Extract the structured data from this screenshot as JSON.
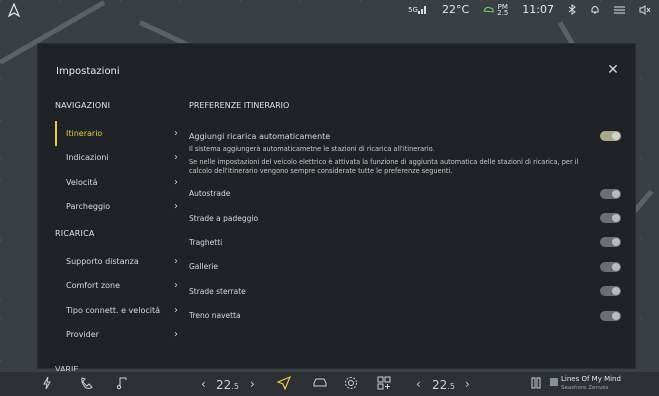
{
  "status": {
    "temperature": "22°C",
    "pm_label": "PM",
    "pm_value": "2.5",
    "signal": "5G",
    "time": "11:07"
  },
  "panel": {
    "title": "Impostazioni",
    "close_label": "✕"
  },
  "sidebar": {
    "navigation_header": "NAVIGAZIONI",
    "navigation_items": [
      {
        "label": "Itinerario"
      },
      {
        "label": "Indicazioni"
      },
      {
        "label": "Velocitá"
      },
      {
        "label": "Parcheggio"
      }
    ],
    "recharge_header": "RICARICA",
    "recharge_items": [
      {
        "label": "Supporto distanza"
      },
      {
        "label": "Comfort zone"
      },
      {
        "label": "Tipo connett. e velocitá"
      },
      {
        "label": "Provider"
      }
    ],
    "cut_header": "VARIE"
  },
  "content": {
    "header": "PREFERENZE ITINERARIO",
    "main_option": {
      "label": "Aggiungi ricarica automaticamente",
      "enabled": true
    },
    "desc1": "Il sistema aggiungerà automaticametne le stazioni di ricarica all'itinerario.",
    "desc2": "Se nelle impostazioni del veicolo elettrico è attivata la funzione di aggiunta automatica delle stazioni di ricarica, per il calcolo dell'itinerario vengono sempre considerate tutte le preferenze seguenti.",
    "options": [
      {
        "label": "Autostrade",
        "enabled": false
      },
      {
        "label": "Strade a padeggio",
        "enabled": false
      },
      {
        "label": "Traghetti",
        "enabled": false
      },
      {
        "label": "Gallerie",
        "enabled": false
      },
      {
        "label": "Strade sterrate",
        "enabled": false
      },
      {
        "label": "Treno navetta",
        "enabled": false
      }
    ]
  },
  "bottom": {
    "left_temp": "22",
    "left_temp_dec": ".5",
    "right_temp": "22",
    "right_temp_dec": ".5",
    "media_title": "Lines Of My Mind",
    "media_artist": "Seashore Zenves"
  },
  "colors": {
    "accent": "#e6c94a",
    "panel_bg": "#1f2327",
    "toggle_on": "#a9a887",
    "toggle_off": "#6b6f73"
  }
}
